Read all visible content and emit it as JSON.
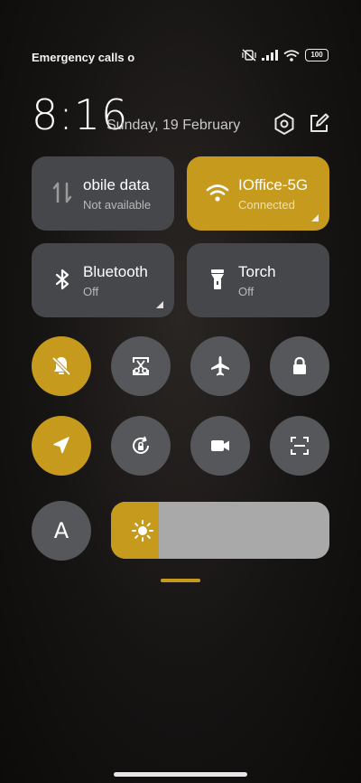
{
  "status_bar": {
    "carrier_text": "Emergency calls o",
    "battery_level": "100",
    "icons": [
      "mute-vibrate-icon",
      "signal-icon",
      "wifi-icon",
      "battery-icon"
    ]
  },
  "header": {
    "time": "8:16",
    "date": "Sunday, 19 February",
    "icons": [
      "settings-icon",
      "edit-icon"
    ]
  },
  "tiles": [
    {
      "id": "mobile-data",
      "title": "obile data",
      "subtitle": "Not available",
      "icon": "mobile-data-icon",
      "active": false
    },
    {
      "id": "wifi",
      "title": "IOffice-5G",
      "subtitle": "Connected",
      "icon": "wifi-icon",
      "active": true
    },
    {
      "id": "bluetooth",
      "title": "Bluetooth",
      "subtitle": "Off",
      "icon": "bluetooth-icon",
      "active": false
    },
    {
      "id": "torch",
      "title": "Torch",
      "subtitle": "Off",
      "icon": "torch-icon",
      "active": false
    }
  ],
  "toggles_row1": [
    {
      "name": "silent-mode",
      "icon": "bell-off-icon",
      "active": true
    },
    {
      "name": "screenshot",
      "icon": "scissors-icon",
      "active": false
    },
    {
      "name": "airplane-mode",
      "icon": "airplane-icon",
      "active": false
    },
    {
      "name": "lock-screen",
      "icon": "lock-icon",
      "active": false
    }
  ],
  "toggles_row2": [
    {
      "name": "location",
      "icon": "location-arrow-icon",
      "active": true
    },
    {
      "name": "auto-rotate",
      "icon": "rotation-lock-icon",
      "active": false
    },
    {
      "name": "screen-recorder",
      "icon": "video-camera-icon",
      "active": false
    },
    {
      "name": "scanner",
      "icon": "scan-icon",
      "active": false
    }
  ],
  "auto_brightness": {
    "label": "A"
  },
  "brightness": {
    "level_percent": 22,
    "icon": "sun-icon"
  },
  "colors": {
    "accent": "#c69a1c",
    "tile": "#45474a",
    "round": "#55575a",
    "slider_track": "#a9a9a9"
  }
}
